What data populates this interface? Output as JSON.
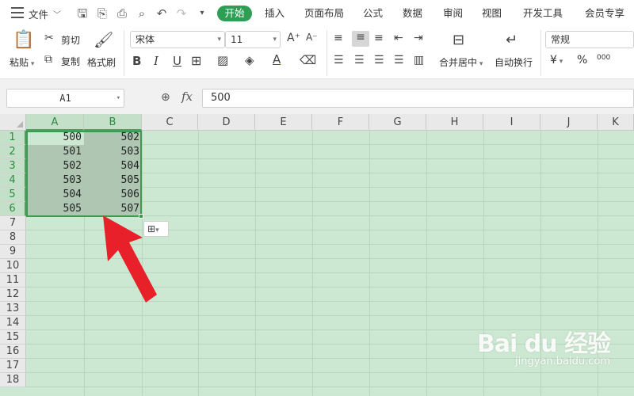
{
  "menu": {
    "file": "文件",
    "tabs": [
      "开始",
      "插入",
      "页面布局",
      "公式",
      "数据",
      "审阅",
      "视图",
      "开发工具",
      "会员专享"
    ]
  },
  "ribbon": {
    "paste": "粘贴",
    "cut": "剪切",
    "copy": "复制",
    "format_painter": "格式刷",
    "font_name": "宋体",
    "font_size": "11",
    "merge_center": "合并居中",
    "wrap_text": "自动换行",
    "number_format": "常规",
    "currency_symbol": "¥",
    "percent_symbol": "%",
    "thousands_symbol": "000"
  },
  "formula_bar": {
    "name_box": "A1",
    "fx": "fx",
    "content": "500"
  },
  "sheet": {
    "columns": [
      "A",
      "B",
      "C",
      "D",
      "E",
      "F",
      "G",
      "H",
      "I",
      "J",
      "K"
    ],
    "rows": [
      "1",
      "2",
      "3",
      "4",
      "5",
      "6",
      "7",
      "8",
      "9",
      "10",
      "11",
      "12",
      "13",
      "14",
      "15",
      "16",
      "17",
      "18"
    ],
    "cells_a": [
      "500",
      "501",
      "502",
      "503",
      "504",
      "505"
    ],
    "cells_b": [
      "502",
      "503",
      "504",
      "505",
      "506",
      "507"
    ]
  },
  "watermark": {
    "title": "Bai du 经验",
    "subtitle": "jingyan.baidu.com"
  },
  "colors": {
    "accent": "#2e9e55",
    "sheet_bg": "#cde8d2",
    "arrow": "#e8202a"
  }
}
